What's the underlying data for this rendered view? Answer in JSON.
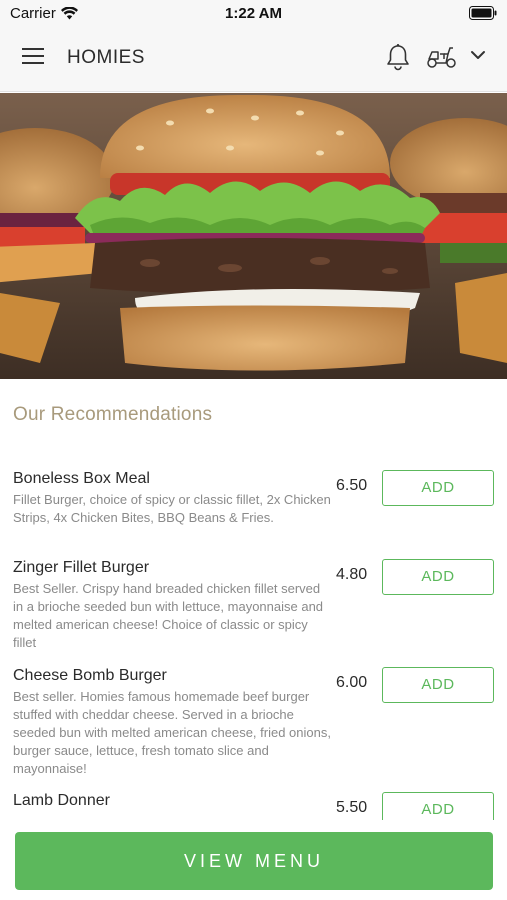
{
  "status_bar": {
    "carrier": "Carrier",
    "time": "1:22 AM"
  },
  "header": {
    "title": "HOMIES",
    "icons": [
      "menu-icon",
      "bell-icon",
      "scooter-icon",
      "chevron-down-icon"
    ]
  },
  "hero": {
    "image": "burger-photo"
  },
  "recommendations": {
    "title": "Our Recommendations",
    "items": [
      {
        "name": "Boneless Box Meal",
        "description": "Fillet Burger, choice of spicy or classic fillet, 2x Chicken Strips, 4x Chicken Bites, BBQ Beans & Fries.",
        "price": "6.50",
        "add_label": "ADD"
      },
      {
        "name": "Zinger Fillet Burger",
        "description": "Best Seller. Crispy hand breaded chicken fillet served in a brioche seeded bun with lettuce, mayonnaise and melted american cheese! Choice of classic or spicy fillet",
        "price": "4.80",
        "add_label": "ADD"
      },
      {
        "name": "Cheese Bomb Burger",
        "description": "Best seller. Homies famous homemade beef burger stuffed with cheddar cheese. Served in a brioche seeded bun with melted american cheese, fried onions, burger sauce, lettuce, fresh tomato slice and mayonnaise!",
        "price": "6.00",
        "add_label": "ADD"
      },
      {
        "name": "Lamb Donner",
        "description": "",
        "price": "5.50",
        "add_label": "ADD"
      }
    ]
  },
  "footer": {
    "view_menu_label": "VIEW MENU"
  },
  "colors": {
    "accent_green": "#5cb85c",
    "section_title": "#a89a7c",
    "header_bg": "#f7f7f7"
  }
}
